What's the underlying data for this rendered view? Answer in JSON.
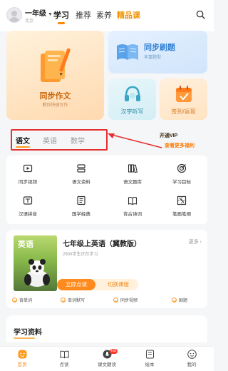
{
  "header": {
    "grade": "一年级",
    "region": "北京",
    "tabs": [
      {
        "label": "学习"
      },
      {
        "label": "推荐"
      },
      {
        "label": "素养"
      },
      {
        "label": "精品课"
      }
    ]
  },
  "feature_cards": {
    "composition": {
      "title": "同步作文",
      "subtitle": "教你快速写作"
    },
    "practice": {
      "title": "同步刷题",
      "subtitle": "丰富题型"
    },
    "dictation": {
      "title": "汉字听写"
    },
    "checkin": {
      "title": "签到/返现"
    }
  },
  "subjects": {
    "tabs": [
      {
        "label": "语文"
      },
      {
        "label": "英语"
      },
      {
        "label": "数学"
      }
    ]
  },
  "vip_banner": {
    "line1": "开通VIP",
    "line2": "查看更多福利"
  },
  "tools": [
    {
      "label": "同步视频",
      "icon": "video-icon"
    },
    {
      "label": "语文资料",
      "icon": "document-stack-icon"
    },
    {
      "label": "语文题库",
      "icon": "books-icon"
    },
    {
      "label": "学习目标",
      "icon": "target-icon"
    },
    {
      "label": "汉语拼音",
      "icon": "pinyin-icon"
    },
    {
      "label": "国学经典",
      "icon": "classics-book-icon"
    },
    {
      "label": "背古诗词",
      "icon": "poem-book-icon"
    },
    {
      "label": "笔画笔顺",
      "icon": "stroke-grid-icon"
    }
  ],
  "book": {
    "cover_title": "英语",
    "title": "七年级上英语（冀教版）",
    "learners": "2900学生正在学习",
    "more": "更多",
    "primary_button": "立即点读",
    "secondary_button": "切换课版",
    "features": [
      {
        "label": "背单词"
      },
      {
        "label": "单词默写"
      },
      {
        "label": "同步视频"
      },
      {
        "label": "剧题"
      }
    ]
  },
  "resources": {
    "title": "学习资料"
  },
  "bottom_nav": {
    "items": [
      {
        "label": "首页",
        "icon": "home-icon"
      },
      {
        "label": "点读",
        "icon": "open-book-icon"
      },
      {
        "label": "课文朗读",
        "icon": "mic-icon",
        "badge": "hot"
      },
      {
        "label": "绘本",
        "icon": "picture-book-icon"
      },
      {
        "label": "我的",
        "icon": "profile-icon"
      }
    ]
  },
  "colors": {
    "accent": "#ff8a00",
    "highlight_box": "#e53030"
  }
}
